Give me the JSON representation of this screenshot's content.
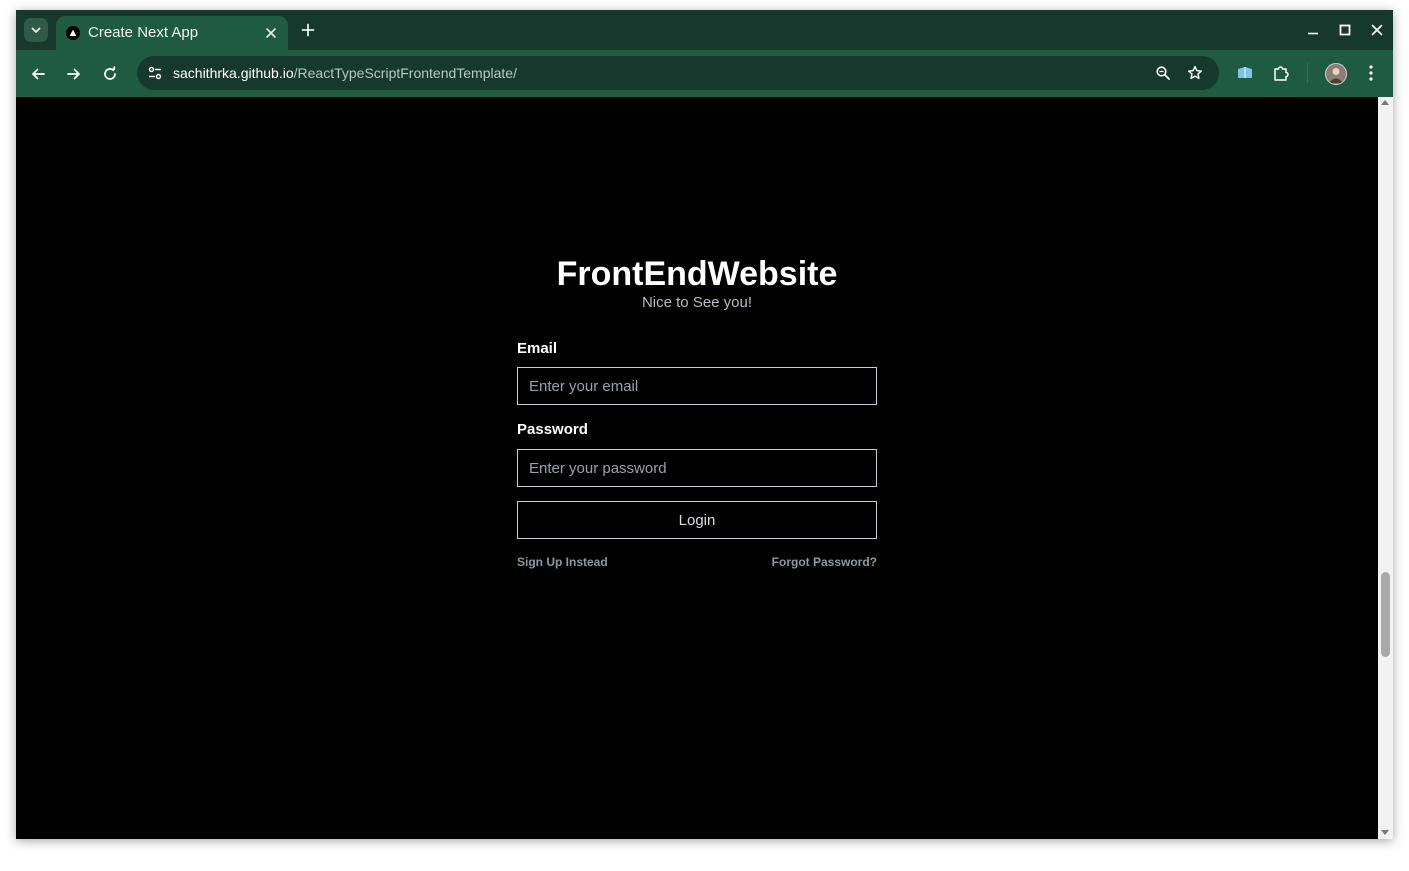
{
  "browser": {
    "tab_title": "Create Next App",
    "url_host": "sachithrka.github.io",
    "url_path": "/ReactTypeScriptFrontendTemplate/",
    "colors": {
      "tabstrip": "#17382c",
      "toolbar": "#1f5a43"
    }
  },
  "page": {
    "brand": "FrontEndWebsite",
    "subtitle": "Nice to See you!",
    "email_label": "Email",
    "email_placeholder": "Enter your email",
    "password_label": "Password",
    "password_placeholder": "Enter your password",
    "login_label": "Login",
    "signup_link": "Sign Up Instead",
    "forgot_link": "Forgot Password?"
  }
}
